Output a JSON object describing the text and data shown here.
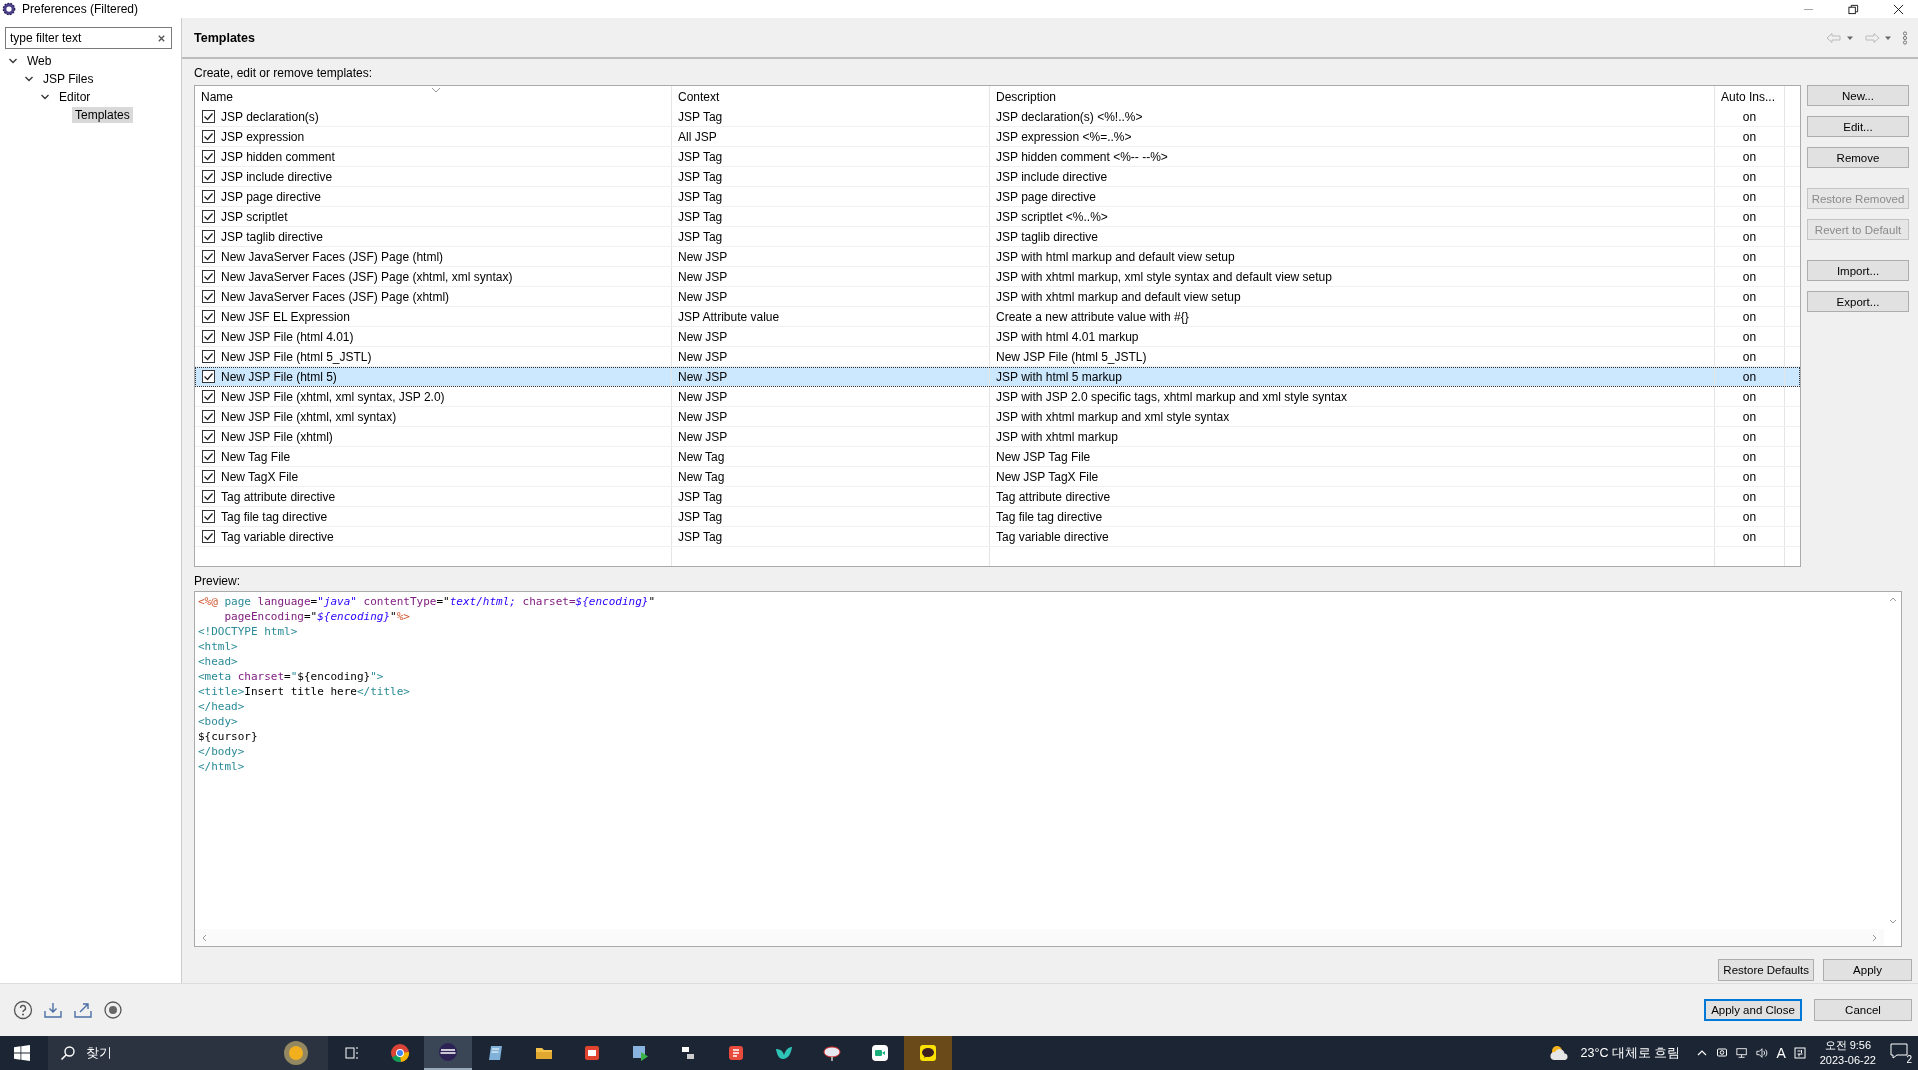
{
  "window": {
    "title": "Preferences (Filtered)"
  },
  "filter": {
    "placeholder": "type filter text"
  },
  "tree": [
    {
      "label": "Web",
      "expanded": true,
      "selected": false,
      "children": [
        {
          "label": "JSP Files",
          "expanded": true,
          "selected": false,
          "children": [
            {
              "label": "Editor",
              "expanded": true,
              "selected": false,
              "children": [
                {
                  "label": "Templates",
                  "selected": true
                }
              ]
            }
          ]
        }
      ]
    }
  ],
  "page": {
    "title": "Templates",
    "intro": "Create, edit or remove templates:",
    "preview_label": "Preview:"
  },
  "table": {
    "columns": [
      "Name",
      "Context",
      "Description",
      "Auto Ins..."
    ],
    "rows": [
      {
        "checked": true,
        "selected": false,
        "name": "JSP declaration(s)",
        "context": "JSP Tag",
        "description": "JSP declaration(s) <%!..%>",
        "auto": "on"
      },
      {
        "checked": true,
        "selected": false,
        "name": "JSP expression",
        "context": "All JSP",
        "description": "JSP expression <%=..%>",
        "auto": "on"
      },
      {
        "checked": true,
        "selected": false,
        "name": "JSP hidden comment",
        "context": "JSP Tag",
        "description": "JSP hidden comment <%-- --%>",
        "auto": "on"
      },
      {
        "checked": true,
        "selected": false,
        "name": "JSP include directive",
        "context": "JSP Tag",
        "description": "JSP include directive",
        "auto": "on"
      },
      {
        "checked": true,
        "selected": false,
        "name": "JSP page directive",
        "context": "JSP Tag",
        "description": "JSP page directive",
        "auto": "on"
      },
      {
        "checked": true,
        "selected": false,
        "name": "JSP scriptlet",
        "context": "JSP Tag",
        "description": "JSP scriptlet <%..%>",
        "auto": "on"
      },
      {
        "checked": true,
        "selected": false,
        "name": "JSP taglib directive",
        "context": "JSP Tag",
        "description": "JSP taglib directive",
        "auto": "on"
      },
      {
        "checked": true,
        "selected": false,
        "name": "New JavaServer Faces (JSF) Page (html)",
        "context": "New JSP",
        "description": "JSP with html markup and default view setup",
        "auto": "on"
      },
      {
        "checked": true,
        "selected": false,
        "name": "New JavaServer Faces (JSF) Page (xhtml, xml syntax)",
        "context": "New JSP",
        "description": "JSP with xhtml markup, xml style syntax and default view setup",
        "auto": "on"
      },
      {
        "checked": true,
        "selected": false,
        "name": "New JavaServer Faces (JSF) Page (xhtml)",
        "context": "New JSP",
        "description": "JSP with xhtml markup and default view setup",
        "auto": "on"
      },
      {
        "checked": true,
        "selected": false,
        "name": "New JSF EL Expression",
        "context": "JSP Attribute value",
        "description": "Create a new attribute value with #{}",
        "auto": "on"
      },
      {
        "checked": true,
        "selected": false,
        "name": "New JSP File (html 4.01)",
        "context": "New JSP",
        "description": "JSP with html 4.01 markup",
        "auto": "on"
      },
      {
        "checked": true,
        "selected": false,
        "name": "New JSP File (html 5_JSTL)",
        "context": "New JSP",
        "description": "New JSP File (html 5_JSTL)",
        "auto": "on"
      },
      {
        "checked": true,
        "selected": true,
        "name": "New JSP File (html 5)",
        "context": "New JSP",
        "description": "JSP with html 5 markup",
        "auto": "on"
      },
      {
        "checked": true,
        "selected": false,
        "name": "New JSP File (xhtml, xml syntax, JSP 2.0)",
        "context": "New JSP",
        "description": "JSP with JSP 2.0 specific tags, xhtml markup and xml style syntax",
        "auto": "on"
      },
      {
        "checked": true,
        "selected": false,
        "name": "New JSP File (xhtml, xml syntax)",
        "context": "New JSP",
        "description": "JSP with xhtml markup and xml style syntax",
        "auto": "on"
      },
      {
        "checked": true,
        "selected": false,
        "name": "New JSP File (xhtml)",
        "context": "New JSP",
        "description": "JSP with xhtml markup",
        "auto": "on"
      },
      {
        "checked": true,
        "selected": false,
        "name": "New Tag File",
        "context": "New Tag",
        "description": "New JSP Tag File",
        "auto": "on"
      },
      {
        "checked": true,
        "selected": false,
        "name": "New TagX File",
        "context": "New Tag",
        "description": "New JSP TagX File",
        "auto": "on"
      },
      {
        "checked": true,
        "selected": false,
        "name": "Tag attribute directive",
        "context": "JSP Tag",
        "description": "Tag attribute directive",
        "auto": "on"
      },
      {
        "checked": true,
        "selected": false,
        "name": "Tag file tag directive",
        "context": "JSP Tag",
        "description": "Tag file tag directive",
        "auto": "on"
      },
      {
        "checked": true,
        "selected": false,
        "name": "Tag variable directive",
        "context": "JSP Tag",
        "description": "Tag variable directive",
        "auto": "on"
      }
    ]
  },
  "side_button_groups": [
    [
      {
        "label": "New...",
        "disabled": false
      },
      {
        "label": "Edit...",
        "disabled": false
      },
      {
        "label": "Remove",
        "disabled": false
      }
    ],
    [
      {
        "label": "Restore Removed",
        "disabled": true
      },
      {
        "label": "Revert to Default",
        "disabled": true
      }
    ],
    [
      {
        "label": "Import...",
        "disabled": false
      },
      {
        "label": "Export...",
        "disabled": false
      }
    ]
  ],
  "preview": [
    [
      {
        "kind": "delim",
        "text": "<%@"
      },
      {
        "kind": "tag",
        "text": " page"
      },
      {
        "kind": "attr",
        "text": " language"
      },
      {
        "kind": "plain",
        "text": "="
      },
      {
        "kind": "value",
        "text": "\"java\""
      },
      {
        "kind": "attr",
        "text": " contentType"
      },
      {
        "kind": "plain",
        "text": "=\""
      },
      {
        "kind": "value",
        "text": "text/html;"
      },
      {
        "kind": "attr",
        "text": " charset="
      },
      {
        "kind": "value",
        "text": "${encoding}"
      },
      {
        "kind": "plain",
        "text": "\""
      }
    ],
    [
      {
        "kind": "attr",
        "text": "    pageEncoding"
      },
      {
        "kind": "plain",
        "text": "=\""
      },
      {
        "kind": "value",
        "text": "${encoding}"
      },
      {
        "kind": "plain",
        "text": "\""
      },
      {
        "kind": "delim",
        "text": "%>"
      }
    ],
    [
      {
        "kind": "tag",
        "text": "<!DOCTYPE html>"
      }
    ],
    [
      {
        "kind": "tag",
        "text": "<html>"
      }
    ],
    [
      {
        "kind": "tag",
        "text": "<head>"
      }
    ],
    [
      {
        "kind": "tag",
        "text": "<meta"
      },
      {
        "kind": "attr",
        "text": " charset"
      },
      {
        "kind": "plain",
        "text": "="
      },
      {
        "kind": "tag",
        "text": "\""
      },
      {
        "kind": "plain",
        "text": "${encoding}"
      },
      {
        "kind": "tag",
        "text": "\">"
      }
    ],
    [
      {
        "kind": "tag",
        "text": "<title>"
      },
      {
        "kind": "plain",
        "text": "Insert title here"
      },
      {
        "kind": "tag",
        "text": "</title>"
      }
    ],
    [
      {
        "kind": "tag",
        "text": "</head>"
      }
    ],
    [
      {
        "kind": "tag",
        "text": "<body>"
      }
    ],
    [
      {
        "kind": "plain",
        "text": "${cursor}"
      }
    ],
    [
      {
        "kind": "tag",
        "text": "</body>"
      }
    ],
    [
      {
        "kind": "tag",
        "text": "</html>"
      }
    ]
  ],
  "bottom_buttons": [
    {
      "label": "Restore Defaults",
      "default": false
    },
    {
      "label": "Apply",
      "default": false
    }
  ],
  "dialog_buttons": [
    {
      "label": "Apply and Close",
      "default": true
    },
    {
      "label": "Cancel",
      "default": false
    }
  ],
  "taskbar": {
    "search": "찾기",
    "weather": "23°C 대체로 흐림",
    "ime": "A",
    "time": "오전 9:56",
    "date": "2023-06-22",
    "notifications": "2"
  }
}
